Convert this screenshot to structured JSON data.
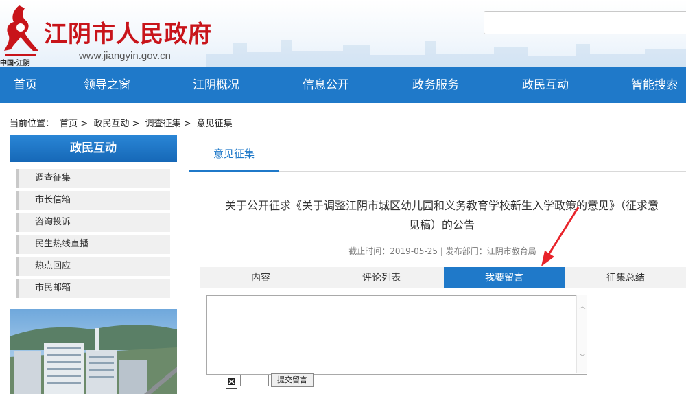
{
  "header": {
    "site_title": "江阴市人民政府",
    "site_url": "www.jiangyin.gov.cn",
    "logo_sub": "中国·江阴",
    "search_placeholder": ""
  },
  "nav": {
    "items": [
      "首页",
      "领导之窗",
      "江阴概况",
      "信息公开",
      "政务服务",
      "政民互动",
      "智能搜索"
    ]
  },
  "breadcrumb": {
    "prefix": "当前位置：",
    "items": [
      "首页 >",
      "政民互动 >",
      "调查征集 >",
      "意见征集"
    ]
  },
  "sidebar": {
    "title": "政民互动",
    "items": [
      "调查征集",
      "市长信箱",
      "咨询投诉",
      "民生热线直播",
      "热点回应",
      "市民邮箱"
    ]
  },
  "main": {
    "tab_label": "意见征集",
    "article_title_line1": "关于公开征求《关于调整江阴市城区幼儿园和义务教育学校新生入学政策的意见》（征求意",
    "article_title_line2": "见稿）的公告",
    "meta": "截止时间：2019-05-25 | 发布部门：江阴市教育局",
    "subtabs": [
      "内容",
      "评论列表",
      "我要留言",
      "征集总结"
    ],
    "active_subtab": "我要留言",
    "comment_value": "",
    "captcha_value": "",
    "submit_label": "提交留言"
  },
  "colors": {
    "brand_blue": "#1f79c9",
    "title_red": "#c8141a",
    "arrow_red": "#e8232a"
  }
}
